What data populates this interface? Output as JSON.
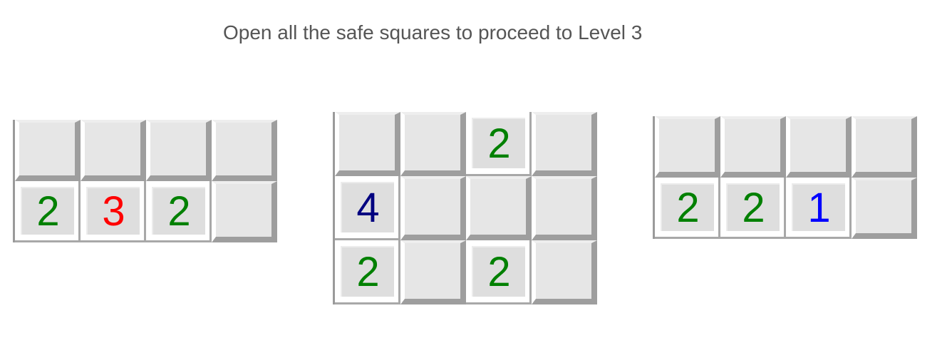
{
  "instruction": "Open all the safe squares to proceed to Level 3",
  "number_colors": {
    "1": "#0000ff",
    "2": "#008000",
    "3": "#ff0000",
    "4": "#000080"
  },
  "boards": [
    {
      "rows": [
        [
          "",
          "",
          "",
          ""
        ],
        [
          "2",
          "3",
          "2",
          ""
        ]
      ]
    },
    {
      "rows": [
        [
          "",
          "",
          "2",
          ""
        ],
        [
          "4",
          "",
          "",
          ""
        ],
        [
          "2",
          "",
          "2",
          ""
        ]
      ]
    },
    {
      "rows": [
        [
          "",
          "",
          "",
          ""
        ],
        [
          "2",
          "2",
          "1",
          ""
        ]
      ]
    }
  ]
}
